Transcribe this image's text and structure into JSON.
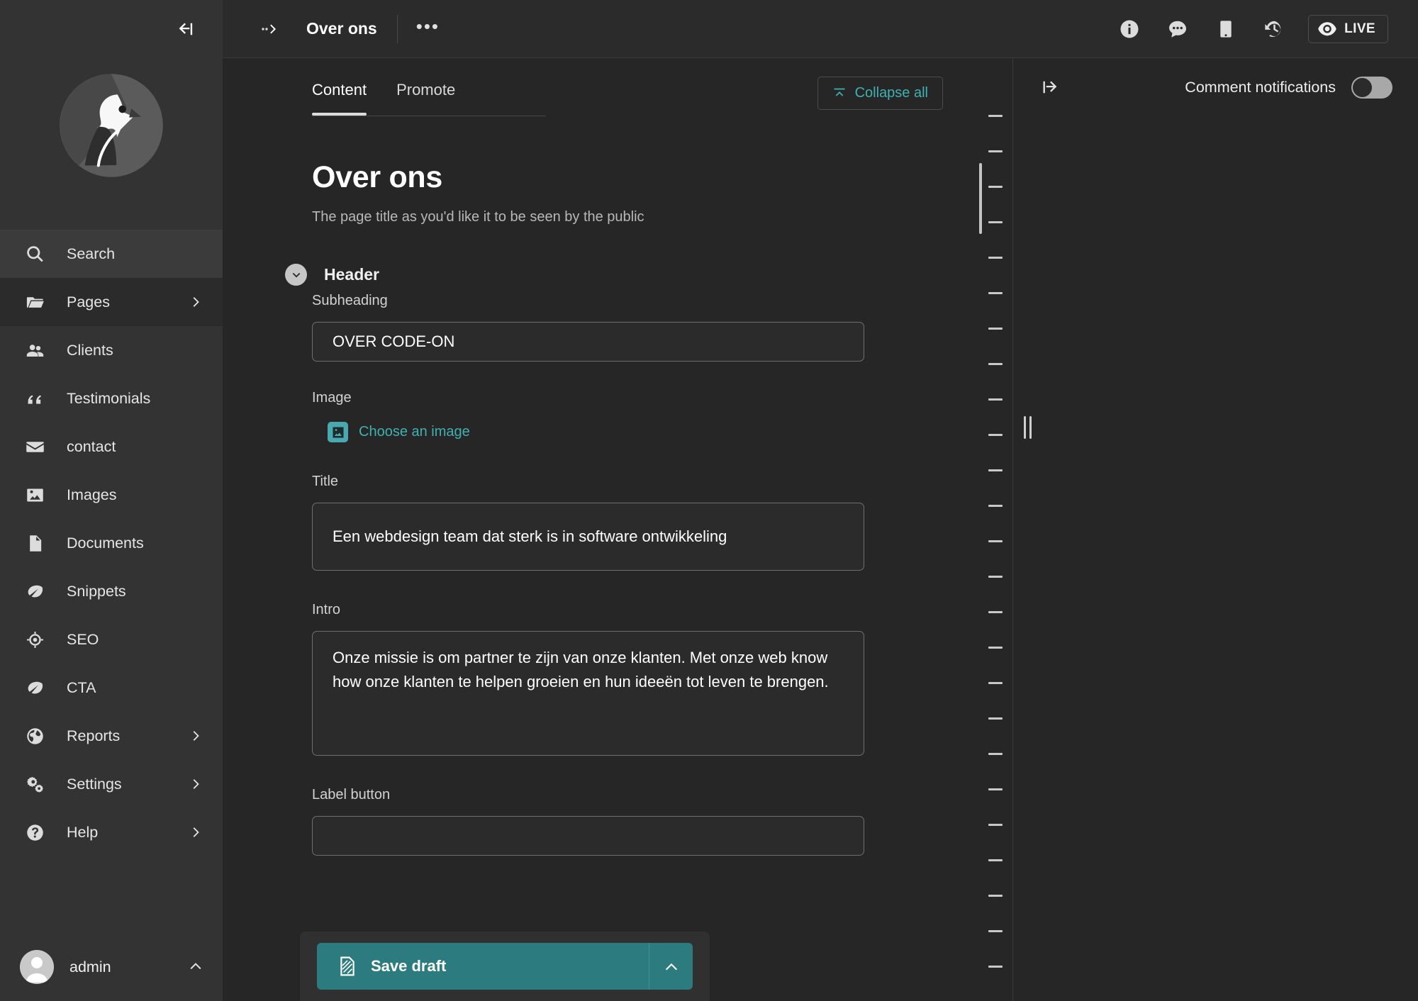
{
  "sidebar": {
    "collapse_icon": "collapse-sidebar-icon",
    "logo": "wagtail-bird-logo",
    "items": [
      {
        "label": "Search",
        "icon": "search-icon",
        "arrow": false,
        "state": "hovered"
      },
      {
        "label": "Pages",
        "icon": "folder-icon",
        "arrow": true,
        "state": "active"
      },
      {
        "label": "Clients",
        "icon": "users-icon",
        "arrow": false,
        "state": ""
      },
      {
        "label": "Testimonials",
        "icon": "quote-icon",
        "arrow": false,
        "state": ""
      },
      {
        "label": "contact",
        "icon": "mail-icon",
        "arrow": false,
        "state": ""
      },
      {
        "label": "Images",
        "icon": "image-icon",
        "arrow": false,
        "state": ""
      },
      {
        "label": "Documents",
        "icon": "document-icon",
        "arrow": false,
        "state": ""
      },
      {
        "label": "Snippets",
        "icon": "snippet-leaf-icon",
        "arrow": false,
        "state": ""
      },
      {
        "label": "SEO",
        "icon": "crosshair-icon",
        "arrow": false,
        "state": ""
      },
      {
        "label": "CTA",
        "icon": "snippet-leaf-icon",
        "arrow": false,
        "state": ""
      },
      {
        "label": "Reports",
        "icon": "globe-icon",
        "arrow": true,
        "state": ""
      },
      {
        "label": "Settings",
        "icon": "cogs-icon",
        "arrow": true,
        "state": ""
      },
      {
        "label": "Help",
        "icon": "question-icon",
        "arrow": true,
        "state": ""
      }
    ],
    "account": {
      "name": "admin",
      "avatar": "user-avatar",
      "caret": "chevron-up-icon"
    }
  },
  "topbar": {
    "breadcrumb_ellipsis": "breadcrumb-ellipsis-icon",
    "page_title": "Over ons",
    "more_actions": "•••",
    "actions": [
      {
        "name": "info-icon",
        "label": "Info"
      },
      {
        "name": "comment-icon",
        "label": "Comments"
      },
      {
        "name": "mobile-preview-icon",
        "label": "Preview"
      },
      {
        "name": "history-icon",
        "label": "History"
      }
    ],
    "live_button": {
      "label": "LIVE",
      "icon": "eye-icon"
    }
  },
  "editor": {
    "tabs": [
      {
        "label": "Content",
        "active": true
      },
      {
        "label": "Promote",
        "active": false
      }
    ],
    "collapse_all": {
      "label": "Collapse all",
      "icon": "collapse-up-icon"
    },
    "page_heading": "Over ons",
    "page_heading_help": "The page title as you'd like it to be seen by the public",
    "section": {
      "title": "Header",
      "chevron": "chevron-down-icon"
    },
    "fields": {
      "subheading": {
        "label": "Subheading",
        "value": "OVER CODE-ON"
      },
      "image": {
        "label": "Image",
        "choose_label": "Choose an image",
        "icon": "image-picker-icon"
      },
      "title": {
        "label": "Title",
        "value": "Een webdesign team dat sterk is in software ontwikkeling"
      },
      "intro": {
        "label": "Intro",
        "value": "Onze missie is om partner te zijn van onze klanten. Met onze web know how onze klanten te helpen groeien en hun ideeën tot leven te brengen."
      },
      "label_button": {
        "label": "Label button",
        "value": ""
      }
    }
  },
  "sidepanel": {
    "expand_icon": "expand-panel-icon",
    "comment_notifications_label": "Comment notifications",
    "comment_notifications_on": false,
    "grip": "panel-resize-grip"
  },
  "footer": {
    "save_label": "Save draft",
    "save_icon": "draft-icon",
    "caret_icon": "chevron-up-icon"
  },
  "colors": {
    "accent_teal": "#3fb1b1",
    "save_button": "#2b7b7f",
    "sidebar_bg": "#333333",
    "page_bg": "#262626",
    "input_border": "#6e6e6e"
  }
}
